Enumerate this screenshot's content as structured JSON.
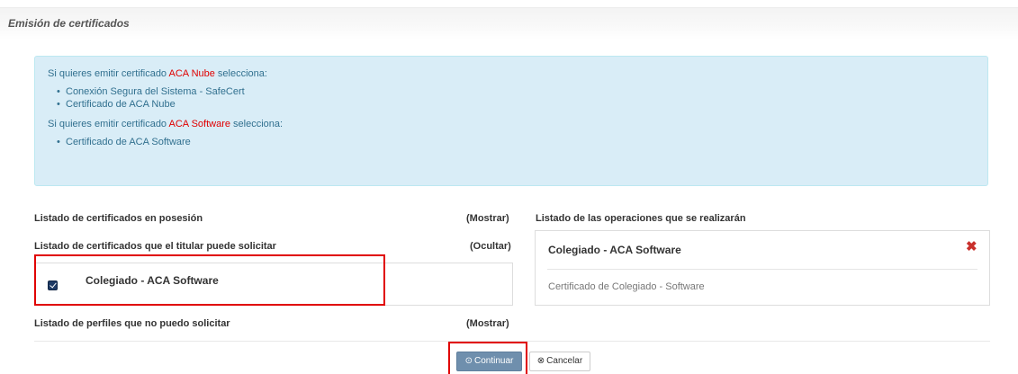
{
  "header": {
    "title": "Emisión de certificados"
  },
  "info": {
    "nube_prefix": "Si quieres emitir certificado ",
    "nube_highlight": "ACA Nube",
    "nube_suffix": " selecciona:",
    "nube_items": [
      "Conexión Segura del Sistema - SafeCert",
      "Certificado de ACA Nube"
    ],
    "software_prefix": "Si quieres emitir certificado ",
    "software_highlight": "ACA Software",
    "software_suffix": " selecciona:",
    "software_items": [
      "Certificado de ACA Software"
    ]
  },
  "lists": {
    "owned_label": "Listado de certificados en posesión",
    "owned_action": "(Mostrar)",
    "requestable_label": "Listado de certificados que el titular puede solicitar",
    "requestable_action": "(Ocultar)",
    "requestable_item": "Colegiado - ACA Software",
    "unavailable_label": "Listado de perfiles que no puedo solicitar",
    "unavailable_action": "(Mostrar)"
  },
  "operations": {
    "label": "Listado de las operaciones que se realizarán",
    "item_title": "Colegiado - ACA Software",
    "item_subtitle": "Certificado de Colegiado - Software"
  },
  "buttons": {
    "continue_label": "Continuar",
    "cancel_label": "Cancelar"
  },
  "icons": {
    "continue": "circle-arrow-right-icon",
    "cancel": "circle-x-icon",
    "remove": "close-icon"
  },
  "colors": {
    "highlight": "#e00000",
    "info_bg": "#d9edf7",
    "primary": "#6f8fad"
  }
}
